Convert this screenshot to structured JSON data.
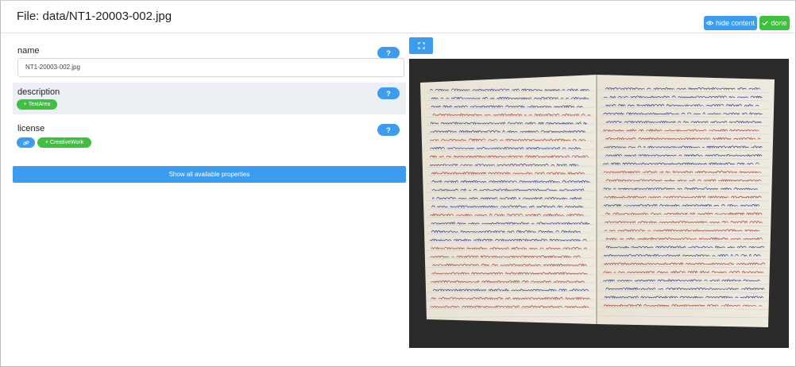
{
  "header": {
    "title": "File: data/NT1-20003-002.jpg",
    "hide_content_label": "hide content",
    "done_label": "done",
    "hide_icon": "eye-icon",
    "done_icon": "check-icon"
  },
  "properties": {
    "name": {
      "label": "name",
      "help": "?",
      "value": "NT1-20003-002.jpg"
    },
    "description": {
      "label": "description",
      "help": "?",
      "add_label": "TextArea"
    },
    "license": {
      "label": "license",
      "help": "?",
      "link_icon": "link-icon",
      "add_label": "CreativeWork"
    }
  },
  "show_all_label": "Show all available properties",
  "image": {
    "icon": "expand-icon",
    "subject": "handwritten notebook page"
  },
  "colors": {
    "primary": "#3b9cf0",
    "success": "#3ec13e",
    "panel": "#ecf0f5"
  }
}
